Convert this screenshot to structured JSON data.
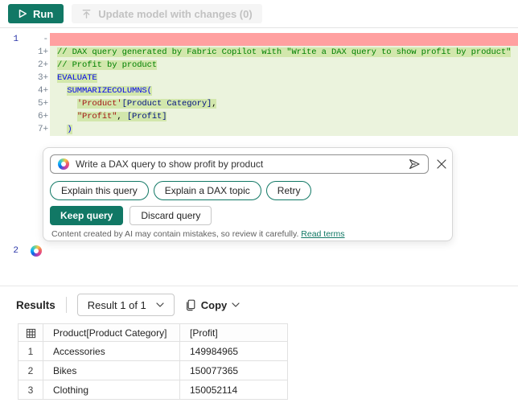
{
  "colors": {
    "accent_teal": "#117865",
    "diff_added_line": "#EBF3DD",
    "diff_added_text": "#D2E7AC",
    "diff_deleted_line": "#FFA0A0",
    "syntax_comment": "#008000",
    "syntax_keyword": "#0000EE",
    "syntax_string": "#A31515",
    "syntax_column": "#001080"
  },
  "toolbar": {
    "run_label": "Run",
    "update_label": "Update model with changes (0)"
  },
  "editor": {
    "lines": [
      {
        "kind": "deleted",
        "orig_num": "1",
        "marker": "-",
        "tokens": []
      },
      {
        "kind": "added",
        "num": "1",
        "marker": "+",
        "tokens": [
          {
            "t": "comment",
            "s": "// DAX query generated by Fabric Copilot with \"Write a DAX query to show profit by product\""
          }
        ]
      },
      {
        "kind": "added",
        "num": "2",
        "marker": "+",
        "tokens": [
          {
            "t": "comment",
            "s": "// Profit by product"
          }
        ]
      },
      {
        "kind": "added",
        "num": "3",
        "marker": "+",
        "tokens": [
          {
            "t": "keyword",
            "s": "EVALUATE"
          }
        ]
      },
      {
        "kind": "added",
        "num": "4",
        "marker": "+",
        "tokens": [
          {
            "t": "indent",
            "s": "  "
          },
          {
            "t": "keyword",
            "s": "SUMMARIZECOLUMNS("
          }
        ]
      },
      {
        "kind": "added",
        "num": "5",
        "marker": "+",
        "tokens": [
          {
            "t": "indent",
            "s": "    "
          },
          {
            "t": "string",
            "s": "'Product'"
          },
          {
            "t": "column",
            "s": "[Product Category]"
          },
          {
            "t": "plain",
            "s": ","
          }
        ]
      },
      {
        "kind": "added",
        "num": "6",
        "marker": "+",
        "tokens": [
          {
            "t": "indent",
            "s": "    "
          },
          {
            "t": "string",
            "s": "\"Profit\""
          },
          {
            "t": "plain",
            "s": ", "
          },
          {
            "t": "column",
            "s": "[Profit]"
          }
        ]
      },
      {
        "kind": "added",
        "num": "7",
        "marker": "+",
        "tokens": [
          {
            "t": "indent",
            "s": "  "
          },
          {
            "t": "keyword",
            "s": ")"
          }
        ]
      }
    ],
    "cursor_line_number": "2"
  },
  "copilot": {
    "prompt_value": "Write a DAX query to show profit by product",
    "suggestions": [
      "Explain this query",
      "Explain a DAX topic",
      "Retry"
    ],
    "keep_label": "Keep query",
    "discard_label": "Discard query",
    "disclaimer": "Content created by AI may contain mistakes, so review it carefully.",
    "terms_link": "Read terms"
  },
  "results": {
    "label": "Results",
    "result_selector": "Result 1 of 1",
    "copy_label": "Copy",
    "table": {
      "columns": [
        "Product[Product Category]",
        "[Profit]"
      ],
      "rows": [
        {
          "n": "1",
          "category": "Accessories",
          "profit": "149984965"
        },
        {
          "n": "2",
          "category": "Bikes",
          "profit": "150077365"
        },
        {
          "n": "3",
          "category": "Clothing",
          "profit": "150052114"
        }
      ]
    }
  }
}
